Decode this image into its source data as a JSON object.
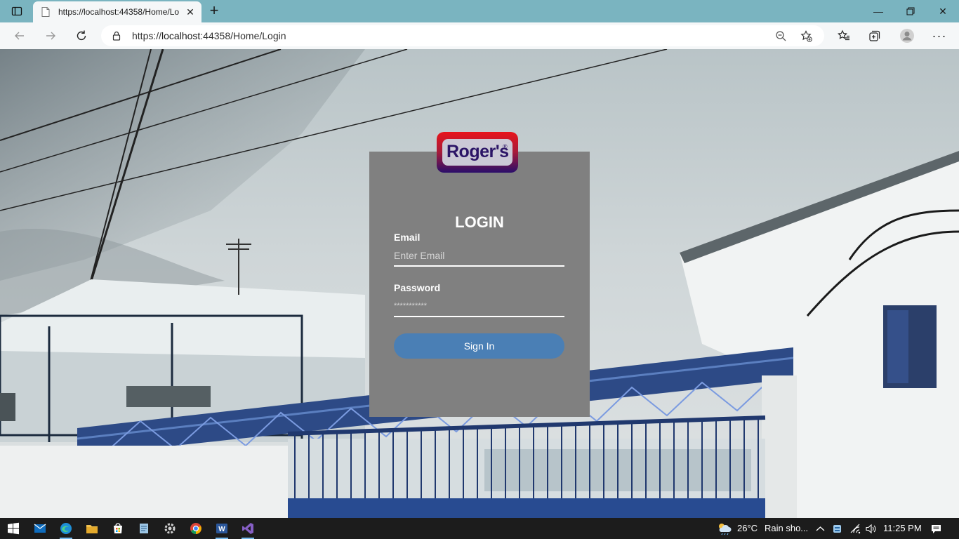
{
  "browser": {
    "tab_title": "https://localhost:44358/Home/Lo",
    "url_prefix": "https://",
    "url_host": "localhost",
    "url_rest": ":44358/Home/Login"
  },
  "login": {
    "logo_text": "Roger's",
    "logo_mark": "®",
    "title": "LOGIN",
    "email_label": "Email",
    "email_placeholder": "Enter Email",
    "password_label": "Password",
    "password_placeholder": "***********",
    "signin_label": "Sign In"
  },
  "taskbar": {
    "apps": [
      "windows-start",
      "mail",
      "edge",
      "file-explorer",
      "store",
      "notepad",
      "settings",
      "chrome",
      "word",
      "visual-studio"
    ],
    "weather_temp": "26°C",
    "weather_text": "Rain sho...",
    "time": "11:25 PM"
  },
  "colors": {
    "tabbar": "#7ab4c0",
    "card": "#808080",
    "signin": "#4a7fb5",
    "taskbar": "#1c1c1c"
  }
}
